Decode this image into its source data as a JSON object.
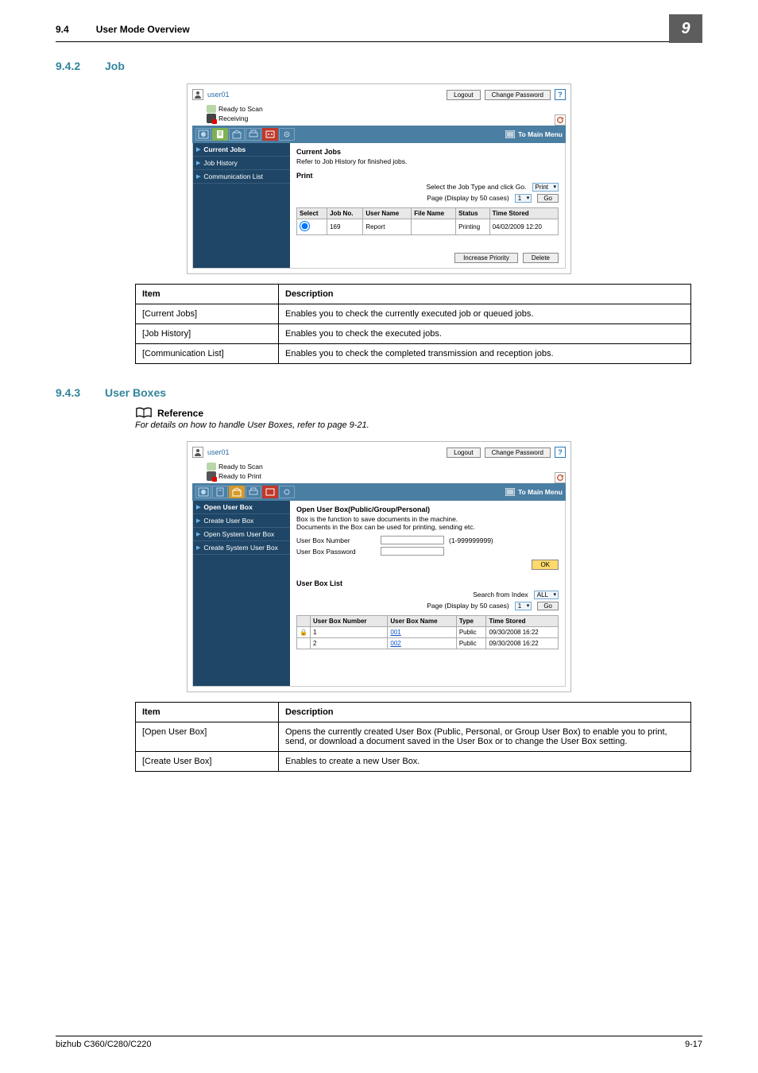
{
  "page": {
    "section_number": "9.4",
    "section_title": "User Mode Overview",
    "side_tab": "9",
    "footer_left": "bizhub C360/C280/C220",
    "footer_right": "9-17"
  },
  "headings": {
    "job_num": "9.4.2",
    "job_title": "Job",
    "ub_num": "9.4.3",
    "ub_title": "User Boxes",
    "reference": "Reference",
    "reference_text": "For details on how to handle User Boxes, refer to page 9-21."
  },
  "desc1": {
    "h_item": "Item",
    "h_desc": "Description",
    "r1_item": "[Current Jobs]",
    "r1_desc": "Enables you to check the currently executed job or queued jobs.",
    "r2_item": "[Job History]",
    "r2_desc": "Enables you to check the executed jobs.",
    "r3_item": "[Communication List]",
    "r3_desc": "Enables you to check the completed transmission and reception jobs."
  },
  "desc2": {
    "h_item": "Item",
    "h_desc": "Description",
    "r1_item": "[Open User Box]",
    "r1_desc": "Opens the currently created User Box (Public, Personal, or Group User Box) to enable you to print, send, or download a document saved in the User Box or to change the User Box setting.",
    "r2_item": "[Create User Box]",
    "r2_desc": "Enables to create a new User Box."
  },
  "shot_common": {
    "user": "user01",
    "logout": "Logout",
    "change_pwd": "Change Password",
    "to_main_menu": "To Main Menu",
    "go": "Go",
    "ok": "OK"
  },
  "shot1": {
    "status1": "Ready to Scan",
    "status2": "Receiving",
    "nav1": "Current Jobs",
    "nav2": "Job History",
    "nav3": "Communication List",
    "title": "Current Jobs",
    "subtitle": "Refer to Job History for finished jobs.",
    "print_label": "Print",
    "select_text": "Select the Job Type and click Go.",
    "page_display": "Page (Display by 50 cases)",
    "type_select": "Print",
    "page_select": "1",
    "th_select": "Select",
    "th_jobno": "Job No.",
    "th_user": "User Name",
    "th_file": "File Name",
    "th_status": "Status",
    "th_time": "Time Stored",
    "row_jobno": "169",
    "row_user": "Report",
    "row_file": "",
    "row_status": "Printing",
    "row_time": "04/02/2009 12:20",
    "btn_priority": "Increase Priority",
    "btn_delete": "Delete"
  },
  "shot2": {
    "status1": "Ready to Scan",
    "status2": "Ready to Print",
    "nav1": "Open User Box",
    "nav2": "Create User Box",
    "nav3": "Open System User Box",
    "nav4": "Create System User Box",
    "title": "Open User Box(Public/Group/Personal)",
    "sub1": "Box is the function to save documents in the machine.",
    "sub2": "Documents in the Box can be used for printing, sending etc.",
    "label_num": "User Box Number",
    "hint": "(1-999999999)",
    "label_pwd": "User Box Password",
    "list_title": "User Box List",
    "search_label": "Search from Index",
    "search_select": "ALL",
    "page_display": "Page (Display by 50 cases)",
    "page_select": "1",
    "th_num": "User Box Number",
    "th_name": "User Box Name",
    "th_type": "Type",
    "th_time": "Time Stored",
    "r1_num": "1",
    "r1_name": "001",
    "r1_type": "Public",
    "r1_time": "09/30/2008 16:22",
    "r2_num": "2",
    "r2_name": "002",
    "r2_type": "Public",
    "r2_time": "09/30/2008 16:22"
  }
}
